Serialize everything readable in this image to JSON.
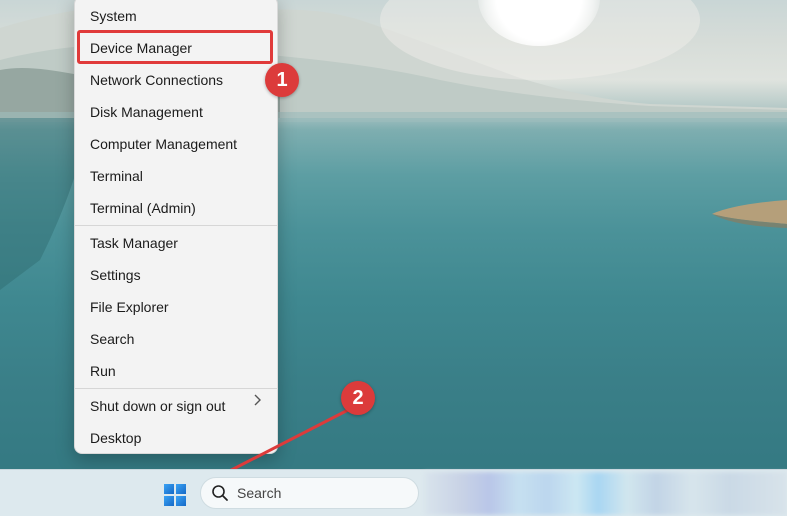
{
  "context_menu": {
    "items": [
      {
        "label": "System"
      },
      {
        "label": "Device Manager"
      },
      {
        "label": "Network Connections"
      },
      {
        "label": "Disk Management"
      },
      {
        "label": "Computer Management"
      },
      {
        "label": "Terminal"
      },
      {
        "label": "Terminal (Admin)"
      },
      {
        "label": "Task Manager"
      },
      {
        "label": "Settings"
      },
      {
        "label": "File Explorer"
      },
      {
        "label": "Search"
      },
      {
        "label": "Run"
      },
      {
        "label": "Shut down or sign out"
      },
      {
        "label": "Desktop"
      }
    ]
  },
  "annotations": {
    "badge_1": "1",
    "badge_2": "2",
    "color": "#dc3b3b"
  },
  "taskbar": {
    "search_placeholder": "Search"
  },
  "icons": {
    "start": "windows-logo-icon",
    "search": "search-icon",
    "submenu": "chevron-right-icon"
  }
}
